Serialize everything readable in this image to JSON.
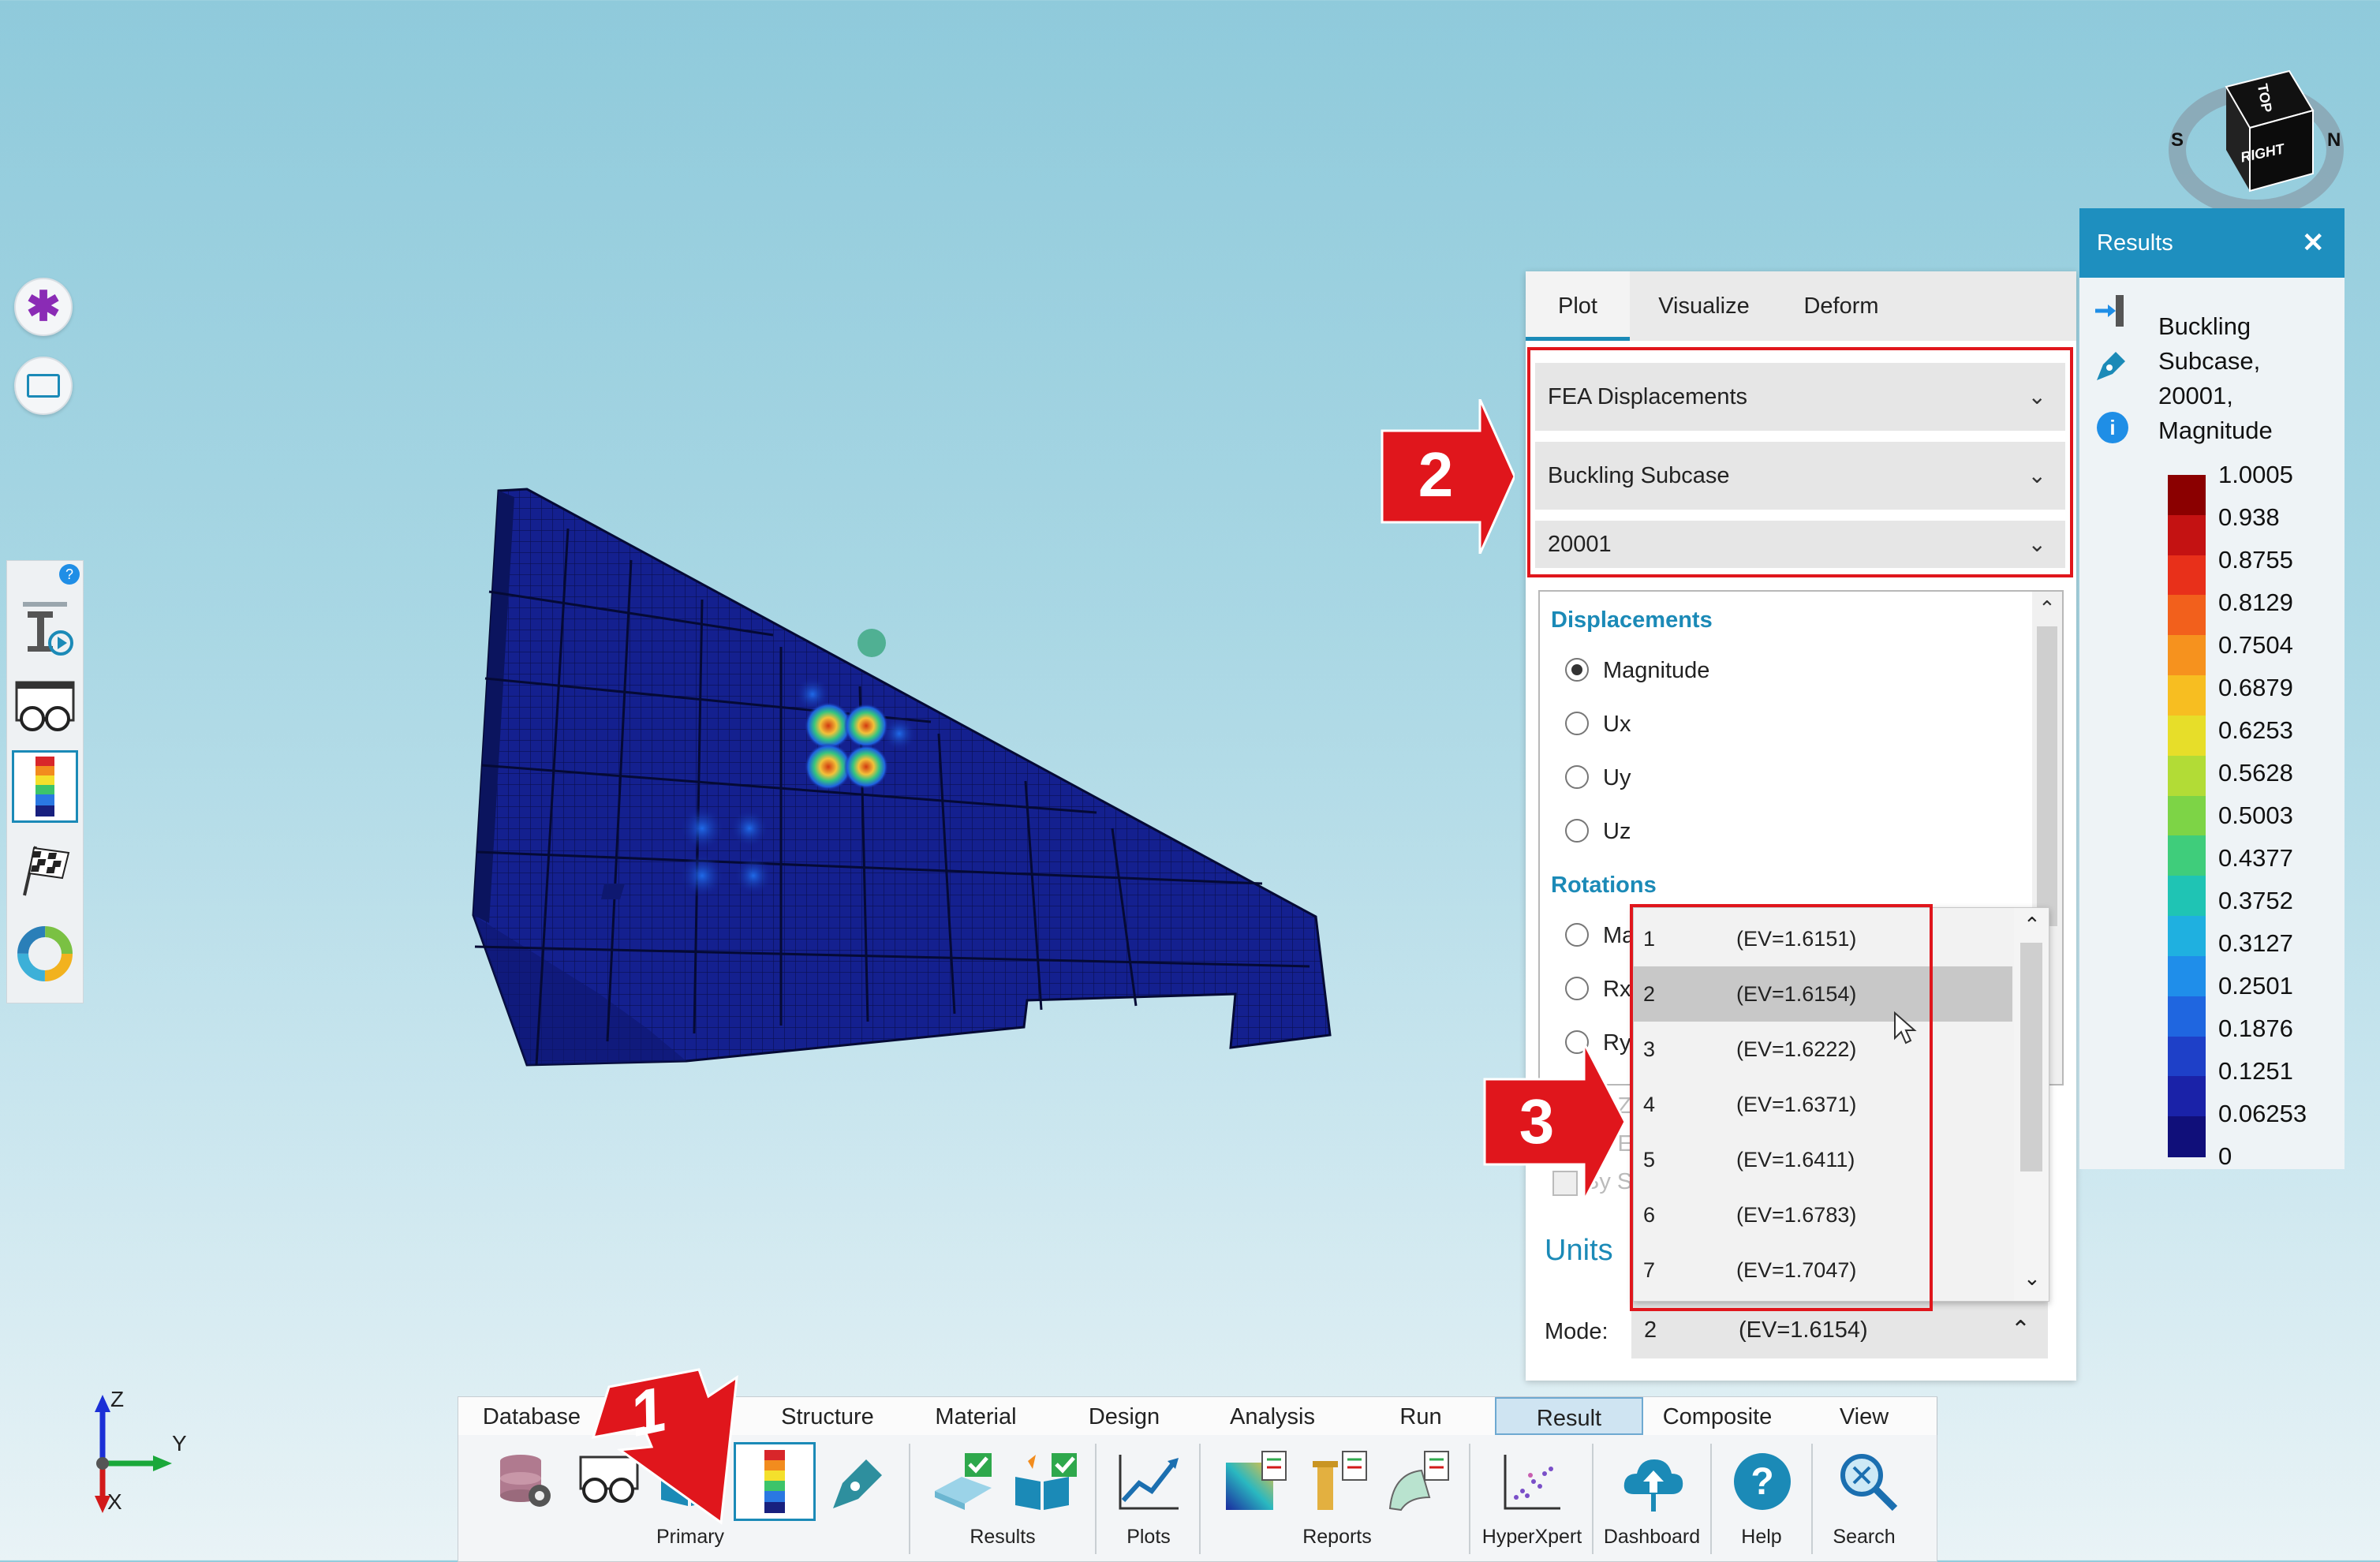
{
  "viewcube": {
    "top_label": "TOP",
    "right_label": "RIGHT",
    "south_label": "S",
    "north_label": "N"
  },
  "axis_triad": {
    "z": "Z",
    "y": "Y",
    "x": "X"
  },
  "panel": {
    "tabs": [
      "Plot",
      "Visualize",
      "Deform"
    ],
    "active_tab": "Plot",
    "result_type": "FEA Displacements",
    "subcase": "Buckling Subcase",
    "load_id": "20001",
    "displacements_header": "Displacements",
    "displacement_options": [
      "Magnitude",
      "Ux",
      "Uy",
      "Uz"
    ],
    "selected_displacement": "Magnitude",
    "rotations_header": "Rotations",
    "rotation_options_partial": [
      "Ma",
      "Rx",
      "Ry"
    ],
    "hidden_option_fragments": [
      "y Z",
      "y E",
      "By S"
    ],
    "units_label": "Units",
    "mode_label": "Mode:",
    "mode_value_num": "2",
    "mode_value_ev": "(EV=1.6154)"
  },
  "mode_list": [
    {
      "num": "1",
      "ev": "(EV=1.6151)"
    },
    {
      "num": "2",
      "ev": "(EV=1.6154)"
    },
    {
      "num": "3",
      "ev": "(EV=1.6222)"
    },
    {
      "num": "4",
      "ev": "(EV=1.6371)"
    },
    {
      "num": "5",
      "ev": "(EV=1.6411)"
    },
    {
      "num": "6",
      "ev": "(EV=1.6783)"
    },
    {
      "num": "7",
      "ev": "(EV=1.7047)"
    }
  ],
  "mode_list_highlighted": "2",
  "results": {
    "title": "Results",
    "close": "✕",
    "description": [
      "Buckling",
      "Subcase,",
      "20001,",
      "Magnitude"
    ],
    "legend_values": [
      "1.0005",
      "0.938",
      "0.8755",
      "0.8129",
      "0.7504",
      "0.6879",
      "0.6253",
      "0.5628",
      "0.5003",
      "0.4377",
      "0.3752",
      "0.3127",
      "0.2501",
      "0.1876",
      "0.1251",
      "0.06253",
      "0"
    ],
    "legend_colors": [
      "#8b0000",
      "#c41212",
      "#e8301a",
      "#f2601c",
      "#f6921e",
      "#f7be21",
      "#e7de29",
      "#b2dc36",
      "#7dd446",
      "#3fcd7b",
      "#1fc4b4",
      "#1fb0e0",
      "#1f8eea",
      "#1f66e0",
      "#1e40c8",
      "#1a22a8",
      "#100f7a"
    ]
  },
  "ribbon": {
    "tabs": [
      "Database",
      "",
      "Structure",
      "Material",
      "Design",
      "Analysis",
      "Run",
      "Result",
      "Composite",
      "View"
    ],
    "active_tab": "Result",
    "groups": [
      "Primary",
      "Results",
      "Plots",
      "Reports",
      "HyperXpert",
      "Dashboard",
      "Help",
      "Search"
    ]
  },
  "callouts": [
    "1",
    "2",
    "3"
  ],
  "colors": {
    "accent": "#1b8ab7",
    "callout_red": "#e0161c",
    "results_header": "#1e8fbf"
  }
}
